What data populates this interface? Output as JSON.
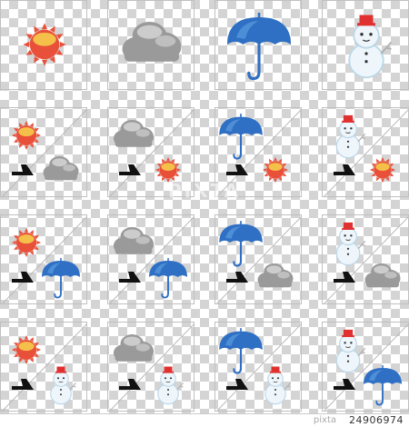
{
  "grid": {
    "tiles": [
      {
        "icons": [
          "sun-icon"
        ]
      },
      {
        "icons": [
          "cloud-icon"
        ]
      },
      {
        "icons": [
          "umbrella-icon"
        ]
      },
      {
        "icons": [
          "snowman-icon"
        ]
      },
      {
        "icons": [
          "sun-icon",
          "arrow-icon",
          "cloud-icon"
        ]
      },
      {
        "icons": [
          "cloud-icon",
          "arrow-icon",
          "sun-icon"
        ]
      },
      {
        "icons": [
          "umbrella-icon",
          "arrow-icon",
          "sun-icon"
        ]
      },
      {
        "icons": [
          "snowman-icon",
          "arrow-icon",
          "sun-icon"
        ]
      },
      {
        "icons": [
          "sun-icon",
          "arrow-icon",
          "umbrella-icon"
        ]
      },
      {
        "icons": [
          "cloud-icon",
          "arrow-icon",
          "umbrella-icon"
        ]
      },
      {
        "icons": [
          "umbrella-icon",
          "arrow-icon",
          "cloud-icon"
        ]
      },
      {
        "icons": [
          "snowman-icon",
          "arrow-icon",
          "cloud-icon"
        ]
      },
      {
        "icons": [
          "sun-icon",
          "arrow-icon",
          "snowman-icon"
        ]
      },
      {
        "icons": [
          "cloud-icon",
          "arrow-icon",
          "snowman-icon"
        ]
      },
      {
        "icons": [
          "umbrella-icon",
          "arrow-icon",
          "snowman-icon"
        ]
      },
      {
        "icons": [
          "snowman-icon",
          "arrow-icon",
          "umbrella-icon"
        ]
      }
    ]
  },
  "colors": {
    "sun": "#e8503a",
    "sun_highlight": "#f5c04a",
    "cloud": "#9a9a9a",
    "cloud_light": "#d8d8d8",
    "umbrella": "#2f6fc4",
    "umbrella_light": "#5b9be0",
    "snowman": "#eef6fb",
    "snowman_hat": "#e03030",
    "arrow": "#111111"
  },
  "watermark": "PIXTA",
  "footer": {
    "brand": "pixta",
    "image_id": "24906974"
  }
}
